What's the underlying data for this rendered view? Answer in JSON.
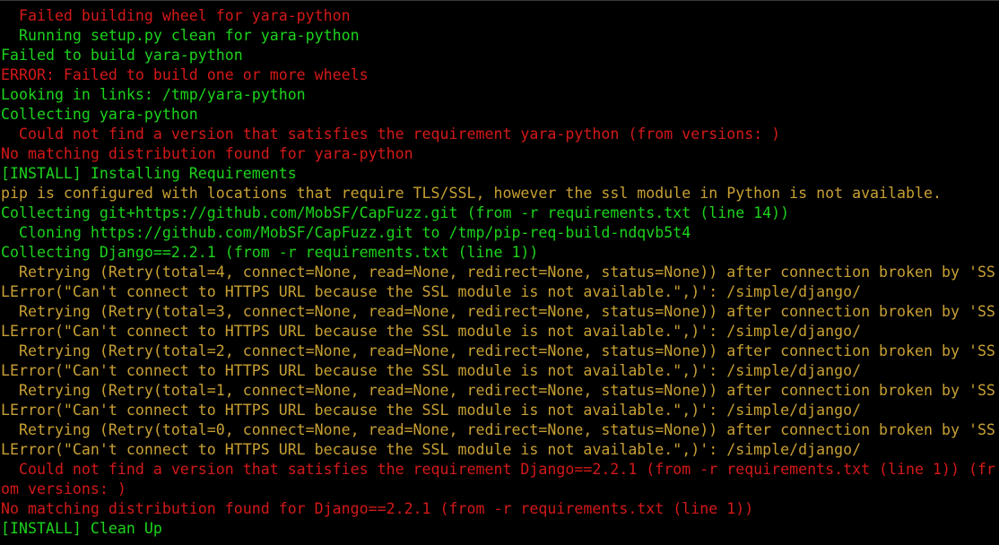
{
  "terminal": {
    "colors": {
      "background": "#000000",
      "red": "#d41919",
      "green": "#1cd31c",
      "white": "#d6d6d6",
      "yellow": "#c8a033"
    },
    "lines": [
      {
        "text": "  Failed building wheel for yara-python",
        "color": "red"
      },
      {
        "text": "  Running setup.py clean for yara-python",
        "color": "green"
      },
      {
        "text": "Failed to build yara-python",
        "color": "green"
      },
      {
        "text": "ERROR: Failed to build one or more wheels",
        "color": "red"
      },
      {
        "text": "Looking in links: /tmp/yara-python",
        "color": "green"
      },
      {
        "text": "Collecting yara-python",
        "color": "green"
      },
      {
        "text": "  Could not find a version that satisfies the requirement yara-python (from versions: )",
        "color": "red"
      },
      {
        "text": "No matching distribution found for yara-python",
        "color": "red"
      },
      {
        "text": "[INSTALL] Installing Requirements",
        "color": "green"
      },
      {
        "text": "pip is configured with locations that require TLS/SSL, however the ssl module in Python is not available.",
        "color": "yellow"
      },
      {
        "text": "Collecting git+https://github.com/MobSF/CapFuzz.git (from -r requirements.txt (line 14))",
        "color": "green"
      },
      {
        "text": "  Cloning https://github.com/MobSF/CapFuzz.git to /tmp/pip-req-build-ndqvb5t4",
        "color": "green"
      },
      {
        "text": "Collecting Django==2.2.1 (from -r requirements.txt (line 1))",
        "color": "green"
      },
      {
        "text": "  Retrying (Retry(total=4, connect=None, read=None, redirect=None, status=None)) after connection broken by 'SS",
        "color": "yellow"
      },
      {
        "text": "LError(\"Can't connect to HTTPS URL because the SSL module is not available.\",)': /simple/django/",
        "color": "yellow"
      },
      {
        "text": "  Retrying (Retry(total=3, connect=None, read=None, redirect=None, status=None)) after connection broken by 'SS",
        "color": "yellow"
      },
      {
        "text": "LError(\"Can't connect to HTTPS URL because the SSL module is not available.\",)': /simple/django/",
        "color": "yellow"
      },
      {
        "text": "  Retrying (Retry(total=2, connect=None, read=None, redirect=None, status=None)) after connection broken by 'SS",
        "color": "yellow"
      },
      {
        "text": "LError(\"Can't connect to HTTPS URL because the SSL module is not available.\",)': /simple/django/",
        "color": "yellow"
      },
      {
        "text": "  Retrying (Retry(total=1, connect=None, read=None, redirect=None, status=None)) after connection broken by 'SS",
        "color": "yellow"
      },
      {
        "text": "LError(\"Can't connect to HTTPS URL because the SSL module is not available.\",)': /simple/django/",
        "color": "yellow"
      },
      {
        "text": "  Retrying (Retry(total=0, connect=None, read=None, redirect=None, status=None)) after connection broken by 'SS",
        "color": "yellow"
      },
      {
        "text": "LError(\"Can't connect to HTTPS URL because the SSL module is not available.\",)': /simple/django/",
        "color": "yellow"
      },
      {
        "text": "  Could not find a version that satisfies the requirement Django==2.2.1 (from -r requirements.txt (line 1)) (fr",
        "color": "red"
      },
      {
        "text": "om versions: )",
        "color": "red"
      },
      {
        "text": "No matching distribution found for Django==2.2.1 (from -r requirements.txt (line 1))",
        "color": "red"
      },
      {
        "text": "[INSTALL] Clean Up",
        "color": "green"
      }
    ]
  }
}
